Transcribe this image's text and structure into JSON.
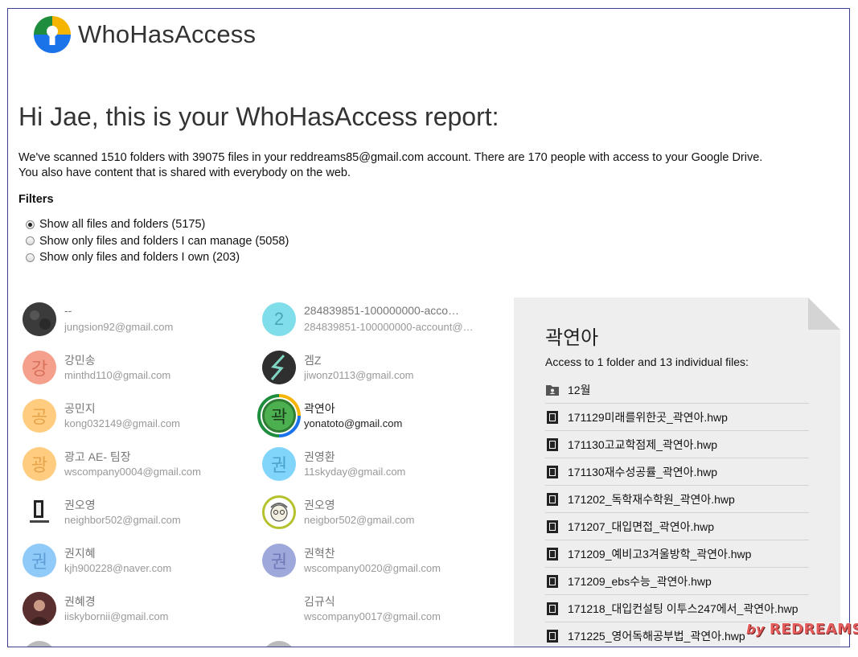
{
  "app": {
    "name": "WhoHasAccess"
  },
  "report": {
    "headline": "Hi Jae, this is your WhoHasAccess report:",
    "summary_line1": "We've scanned 1510 folders with 39075 files in your reddreams85@gmail.com account. There are 170 people with access to your Google Drive.",
    "summary_line2": "You also have content that is shared with everybody on the web."
  },
  "filters": {
    "title": "Filters",
    "options": [
      {
        "label": "Show all files and folders (5175)",
        "checked": true
      },
      {
        "label": "Show only files and folders I can manage (5058)",
        "checked": false
      },
      {
        "label": "Show only files and folders I own (203)",
        "checked": false
      }
    ]
  },
  "people": [
    {
      "name": "--",
      "email": "jungsion92@gmail.com",
      "avatar_char": "",
      "avatar_color": "#3a3a3a"
    },
    {
      "name": "284839851-100000000-acco…",
      "email": "284839851-100000000-account@…",
      "avatar_char": "2",
      "avatar_color": "#80deea"
    },
    {
      "name": "강민송",
      "email": "minthd110@gmail.com",
      "avatar_char": "강",
      "avatar_color": "#f4a08c"
    },
    {
      "name": "겜Z",
      "email": "jiwonz0113@gmail.com",
      "avatar_char": "",
      "avatar_color": "#2f2f2f"
    },
    {
      "name": "공민지",
      "email": "kong032149@gmail.com",
      "avatar_char": "공",
      "avatar_color": "#ffcc80"
    },
    {
      "name": "곽연아",
      "email": "yonatoto@gmail.com",
      "avatar_char": "곽",
      "avatar_color": "#4caf50",
      "selected": true
    },
    {
      "name": "광고 AE- 팀장",
      "email": "wscompany0004@gmail.com",
      "avatar_char": "광",
      "avatar_color": "#ffcc80"
    },
    {
      "name": "권영환",
      "email": "11skyday@gmail.com",
      "avatar_char": "권",
      "avatar_color": "#81d4fa"
    },
    {
      "name": "권오영",
      "email": "neighbor502@gmail.com",
      "avatar_char": "",
      "avatar_color": "#ffffff"
    },
    {
      "name": "권오영",
      "email": "neigbor502@gmail.com",
      "avatar_char": "",
      "avatar_color": "#cddc39"
    },
    {
      "name": "권지혜",
      "email": "kjh900228@naver.com",
      "avatar_char": "권",
      "avatar_color": "#90caf9"
    },
    {
      "name": "권혁찬",
      "email": "wscompany0020@gmail.com",
      "avatar_char": "권",
      "avatar_color": "#9fa8da"
    },
    {
      "name": "권혜경",
      "email": "iiskybornii@gmail.com",
      "avatar_char": "",
      "avatar_color": "#6d3b3b"
    },
    {
      "name": "김규식",
      "email": "wscompany0017@gmail.com",
      "avatar_char": "",
      "avatar_color": "#ffffff"
    }
  ],
  "detail": {
    "name": "곽연아",
    "access_summary": "Access to 1 folder and 13 individual files:",
    "files": [
      {
        "name": "12월",
        "icon": "folder-shared-icon"
      },
      {
        "name": "171129미래를위한곳_곽연아.hwp",
        "icon": "file-icon"
      },
      {
        "name": "171130고교학점제_곽연아.hwp",
        "icon": "file-icon"
      },
      {
        "name": "171130재수성공률_곽연아.hwp",
        "icon": "file-icon"
      },
      {
        "name": "171202_독학재수학원_곽연아.hwp",
        "icon": "file-icon"
      },
      {
        "name": "171207_대입면접_곽연아.hwp",
        "icon": "file-icon"
      },
      {
        "name": "171209_예비고3겨울방학_곽연아.hwp",
        "icon": "file-icon"
      },
      {
        "name": "171209_ebs수능_곽연아.hwp",
        "icon": "file-icon"
      },
      {
        "name": "171218_대입컨설팅 이투스247에서_곽연아.hwp",
        "icon": "file-icon"
      },
      {
        "name": "171225_영어독해공부법_곽연아.hwp",
        "icon": "file-icon"
      }
    ]
  },
  "watermark": {
    "by": "by",
    "text": "REDREAMS"
  },
  "colors": {
    "accent_selected": "#2e7d32",
    "panel_bg": "#eeeeee",
    "frame_border": "#3b3f8f"
  }
}
